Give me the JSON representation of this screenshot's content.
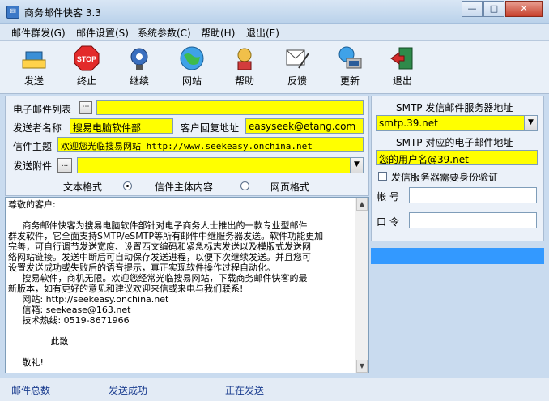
{
  "window": {
    "title": "商务邮件快客 3.3"
  },
  "menu": [
    "邮件群发(G)",
    "邮件设置(S)",
    "系统参数(C)",
    "帮助(H)",
    "退出(E)"
  ],
  "toolbar": [
    {
      "label": "发送",
      "icon": "send-icon"
    },
    {
      "label": "终止",
      "icon": "stop-icon"
    },
    {
      "label": "继续",
      "icon": "continue-icon"
    },
    {
      "label": "网站",
      "icon": "globe-icon"
    },
    {
      "label": "帮助",
      "icon": "help-icon"
    },
    {
      "label": "反馈",
      "icon": "feedback-icon"
    },
    {
      "label": "更新",
      "icon": "update-icon"
    },
    {
      "label": "退出",
      "icon": "exit-icon"
    }
  ],
  "form": {
    "email_list_label": "电子邮件列表",
    "email_list_value": "",
    "sender_label": "发送者名称",
    "sender_value": "搜易电脑软件部",
    "reply_label": "客户回复地址",
    "reply_value": "easyseek@etang.com",
    "subject_label": "信件主题",
    "subject_value": "欢迎您光临搜易网站 http://www.seekeasy.onchina.net",
    "attach_label": "发送附件",
    "attach_btn": "...",
    "format_label": "文本格式",
    "body_option": "信件主体内容",
    "web_option": "网页格式"
  },
  "smtp": {
    "server_label": "SMTP 发信邮件服务器地址",
    "server_value": "smtp.39.net",
    "email_label": "SMTP 对应的电子邮件地址",
    "email_value": "您的用户名@39.net",
    "auth_label": "发信服务器需要身份验证",
    "account_label": "帐 号",
    "password_label": "口 令"
  },
  "body_lines": [
    "尊敬的客户:",
    "",
    "     商务邮件快客为搜易电脑软件部针对电子商务人士推出的一款专业型邮件",
    "群发软件，它全面支持SMTP/eSMTP等所有邮件中继服务器发送。软件功能更加",
    "完善，可自行调节发送宽度、设置西文编码和紧急标志发送以及模版式发送网",
    "络网站链接。发送中断后可自动保存发送进程，以便下次继续发送。并且您可",
    "设置发送成功或失败后的语音提示，真正实现软件操作过程自动化。",
    "     搜易软件，商机无限。欢迎您经常光临搜易网站，下载商务邮件快客的最",
    "新版本，如有更好的意见和建议欢迎来信或来电与我们联系!",
    "     网站: http://seekeasy.onchina.net",
    "     信箱: seekease@163.net",
    "     技术热线: 0519-8671966",
    "",
    "               此致",
    "",
    "     敬礼!"
  ],
  "status": {
    "total": "邮件总数",
    "success": "发送成功",
    "sending": "正在发送"
  },
  "colors": {
    "yellow": "#ffff00",
    "selected": "#3399ff"
  }
}
